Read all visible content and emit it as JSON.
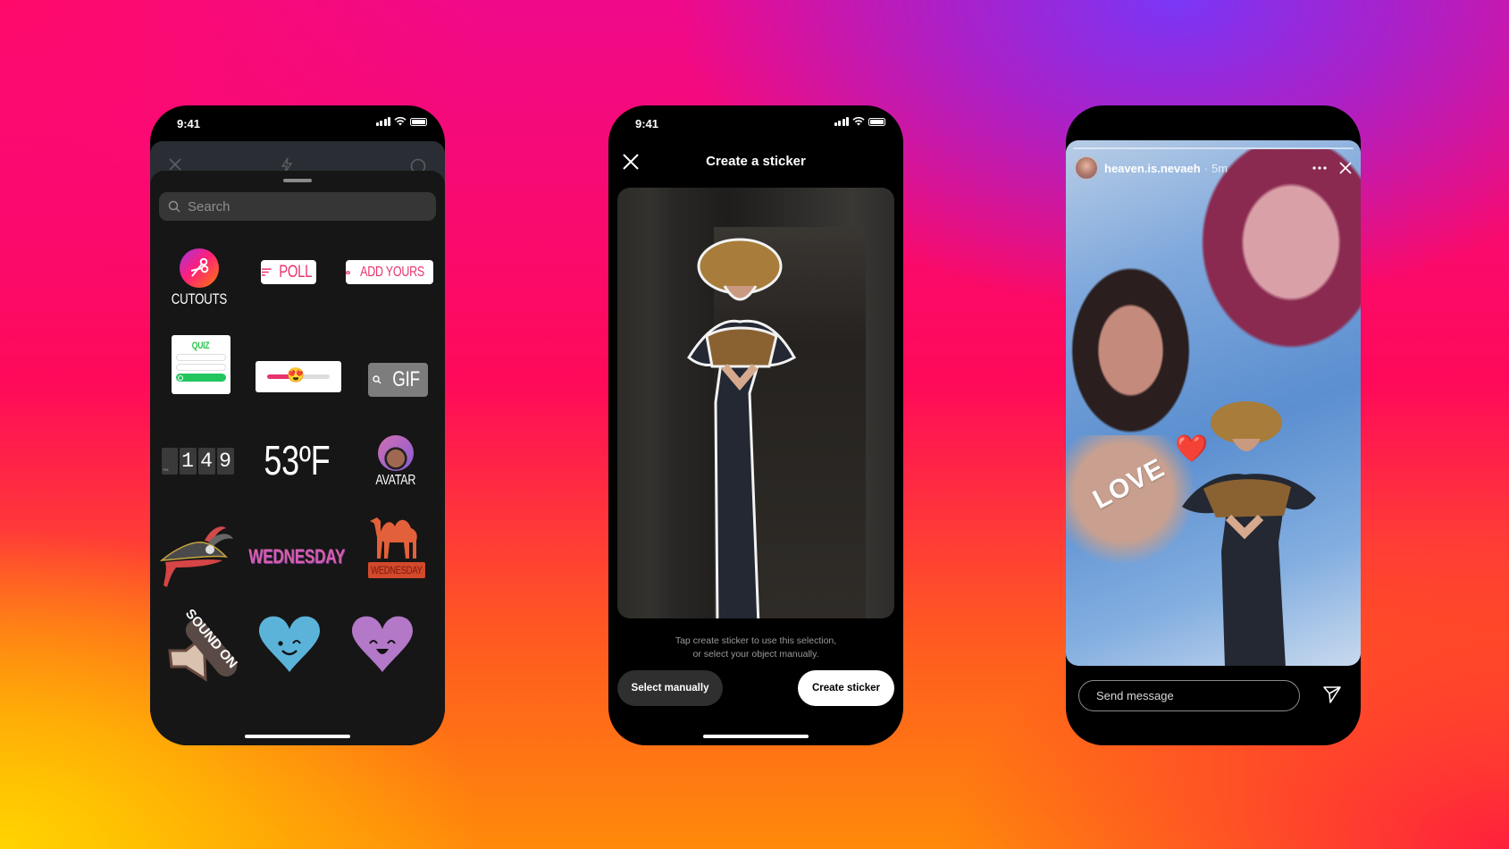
{
  "background": {
    "colors": [
      "#ff0a6a",
      "#7a36f6",
      "#ffd400",
      "#ff1f3d",
      "#ff8a0a"
    ]
  },
  "phones": [
    {
      "status": {
        "time": "9:41"
      },
      "camera_layer": {
        "icons": [
          "close-icon",
          "flash-icon",
          "settings-icon"
        ]
      },
      "tray": {
        "search": {
          "placeholder": "Search"
        },
        "stickers": {
          "cutouts": "CUTOUTS",
          "poll": "POLL",
          "add_yours": "ADD YOURS",
          "quiz": "QUIZ",
          "slider_emoji": "😍",
          "gif": "GIF",
          "clock": {
            "period": "PM",
            "digits": [
              "1",
              "4",
              "9"
            ]
          },
          "weather": "53ºF",
          "avatar": "AVATAR",
          "wednesday_text": "WEDNESDAY",
          "wednesday_camel": "WEDNESDAY",
          "sound_on": "SOUND ON"
        }
      }
    },
    {
      "status": {
        "time": "9:41"
      },
      "header": {
        "title": "Create a sticker"
      },
      "hint": {
        "line1": "Tap create sticker to use this selection,",
        "line2": "or select your object manually."
      },
      "buttons": {
        "select_manually": "Select manually",
        "create_sticker": "Create sticker"
      }
    },
    {
      "story": {
        "username": "heaven.is.nevaeh",
        "separator": "·",
        "time": "5m",
        "sticker_text": "LOVE",
        "sticker_emoji": "❤️"
      },
      "reply": {
        "placeholder": "Send message"
      }
    }
  ]
}
